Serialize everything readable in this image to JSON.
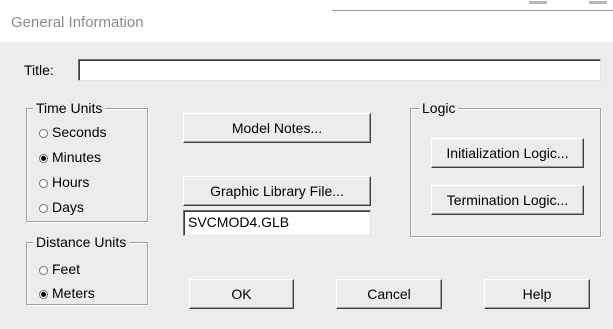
{
  "window": {
    "title": "General Information"
  },
  "title_field": {
    "label": "Title:",
    "value": ""
  },
  "time_units": {
    "label": "Time Units",
    "options": [
      "Seconds",
      "Minutes",
      "Hours",
      "Days"
    ],
    "selected": "Minutes"
  },
  "distance_units": {
    "label": "Distance Units",
    "options": [
      "Feet",
      "Meters"
    ],
    "selected": "Meters"
  },
  "buttons": {
    "model_notes": "Model Notes...",
    "graphic_library": "Graphic Library File...",
    "ok": "OK",
    "cancel": "Cancel",
    "help": "Help"
  },
  "graphic_library_file": {
    "value": "SVCMOD4.GLB"
  },
  "logic": {
    "label": "Logic",
    "initialization": "Initialization Logic...",
    "termination": "Termination Logic..."
  },
  "colors": {
    "dialog_bg": "#ececec",
    "title_text": "#8a8a8a"
  }
}
